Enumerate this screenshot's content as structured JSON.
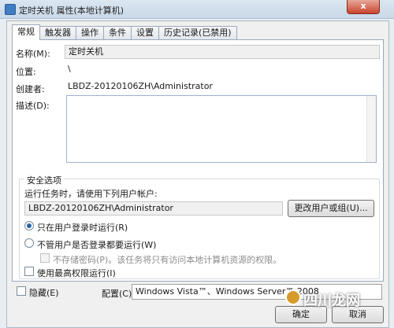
{
  "window": {
    "title": "定时关机 属性(本地计算机)",
    "close_label": "x"
  },
  "tabs": [
    {
      "label": "常规",
      "active": true
    },
    {
      "label": "触发器"
    },
    {
      "label": "操作"
    },
    {
      "label": "条件"
    },
    {
      "label": "设置"
    },
    {
      "label": "历史记录(已禁用)"
    }
  ],
  "general": {
    "name_label": "名称(M):",
    "name_value": "定时关机",
    "location_label": "位置:",
    "location_value": "\\",
    "author_label": "创建者:",
    "author_value": "LBDZ-20120106ZH\\Administrator",
    "description_label": "描述(D):"
  },
  "security": {
    "group_title": "安全选项",
    "run_as_prompt": "运行任务时，请使用下列用户帐户:",
    "user_account": "LBDZ-20120106ZH\\Administrator",
    "change_user_button": "更改用户或组(U)...",
    "option_logged_on": "只在用户登录时运行(R)",
    "option_always": "不管用户是否登录都要运行(W)",
    "no_store_password": "不存储密码(P)。该任务将只有访问本地计算机资源的权限。",
    "highest_privileges": "使用最高权限运行(I)"
  },
  "footer": {
    "hidden_label": "隐藏(E)",
    "configure_label": "配置(C):",
    "configure_value": "Windows Vista™、Windows Server™ 2008",
    "ok_button": "确定",
    "cancel_button": "取消"
  },
  "watermark": {
    "text": "四川龙网"
  }
}
